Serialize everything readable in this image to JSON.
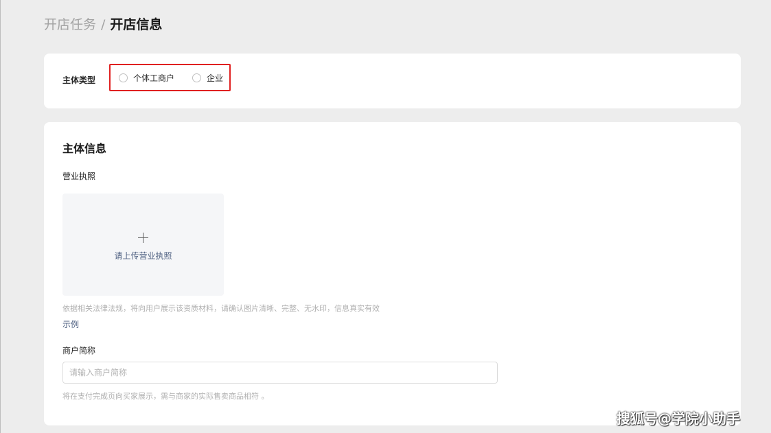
{
  "breadcrumb": {
    "parent": "开店任务",
    "separator": "/",
    "current": "开店信息"
  },
  "entity_type": {
    "label": "主体类型",
    "options": [
      {
        "label": "个体工商户",
        "selected": false
      },
      {
        "label": "企业",
        "selected": false
      }
    ]
  },
  "entity_info": {
    "title": "主体信息",
    "business_license": {
      "label": "营业执照",
      "upload_text": "请上传营业执照",
      "hint": "依据相关法律法规，将向用户展示该资质材料，请确认图片清晰、完整、无水印，信息真实有效",
      "example_link": "示例"
    },
    "merchant_short_name": {
      "label": "商户简称",
      "value": "",
      "placeholder": "请输入商户简称",
      "hint": "将在支付完成页向买家展示，需与商家的实际售卖商品相符 。"
    }
  },
  "watermark": "搜狐号@学院小助手",
  "colors": {
    "page_bg": "#ededed",
    "card_bg": "#ffffff",
    "highlight_border": "#e02020",
    "link": "#4d5f80",
    "hint_text": "#b0b0b0"
  }
}
